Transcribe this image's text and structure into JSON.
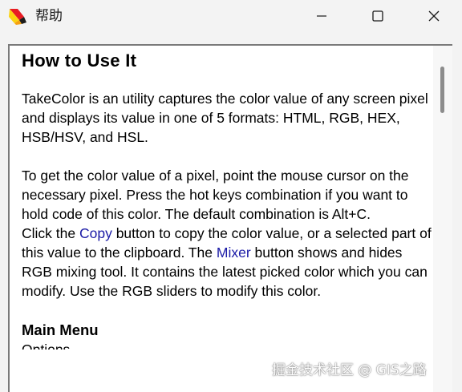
{
  "window": {
    "title": "帮助",
    "icon": "takecolor-app-icon",
    "controls": {
      "minimize_icon": "minimize-icon",
      "maximize_icon": "maximize-icon",
      "close_icon": "close-icon"
    }
  },
  "doc": {
    "heading": "How to Use It",
    "p1": "TakeColor is an utility captures the color value of any screen pixel and displays its value in one of 5 formats: HTML, RGB, HEX, HSB/HSV, and HSL.",
    "p2": "To get the color value of a pixel, point the mouse cursor on the necessary pixel. Press the hot keys combination if you want to hold code of this color. The default combination is Alt+C.",
    "p3": {
      "before_copy": "Click the ",
      "copy_link": "Copy",
      "after_copy": " button to copy the color value, or a selected part of this value to the clipboard. The ",
      "mixer_link": "Mixer",
      "after_mixer": " button shows and hides RGB mixing tool. It contains the latest picked color which you can modify. Use the RGB sliders to modify this color."
    },
    "section_heading": "Main Menu",
    "cut_text": "Options"
  },
  "scrollbar": {
    "position_fraction": 0.0
  },
  "watermark": "掘金技术社区 @ GIS之路",
  "colors": {
    "link": "#1a1aa6",
    "title_bg": "#f3f3f3",
    "content_bg": "#ffffff"
  }
}
